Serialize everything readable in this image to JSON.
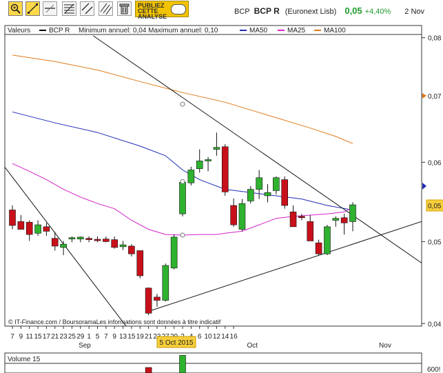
{
  "toolbar": {
    "tools": [
      "zoom-tool",
      "line-tool",
      "horizontal-line-tool",
      "fibonacci-tool",
      "channel-tool",
      "parallel-lines-tool",
      "delete-tool"
    ],
    "promo_lines": [
      "PUBLIEZ",
      "CETTE",
      "ANALYSE"
    ]
  },
  "quote": {
    "symbol": "BCP",
    "name": "BCP R",
    "exchange": "(Euronext Lisb)",
    "price": "0,05",
    "change": "+4,40%",
    "date": "2 Nov"
  },
  "legend": {
    "label": "Valeurs",
    "items": [
      {
        "name": "BCP R",
        "color": "#000000"
      },
      {
        "name": "MA50",
        "color": "#1f2bb5"
      },
      {
        "name": "MA25",
        "color": "#d321c8"
      },
      {
        "name": "MA100",
        "color": "#e07a1a"
      }
    ],
    "minmax": "Minimum annuel: 0,04 Maximum annuel: 0,10"
  },
  "price_axis": {
    "labels": [
      {
        "value": 0.0805,
        "text": "0,08"
      },
      {
        "value": 0.0715,
        "text": "0,07"
      },
      {
        "value": 0.0612,
        "text": "0,06"
      },
      {
        "value": 0.0489,
        "text": "0,05"
      },
      {
        "value": 0.0362,
        "text": "0,04"
      }
    ],
    "current_text": "0,05"
  },
  "x_axis": {
    "ticks": [
      "7",
      "9",
      "11",
      "15",
      "17",
      "21",
      "23",
      "25",
      "29",
      "1",
      "5",
      "7",
      "9",
      "13",
      "15",
      "19",
      "21",
      "23",
      "27",
      "29",
      "2",
      "4",
      "6",
      "10",
      "12",
      "14",
      "16"
    ],
    "months": [
      "Sep",
      "Oct",
      "Nov"
    ],
    "highlight_date": "5 Oct 2015"
  },
  "source_note": "© IT-Finance.com / BoursoramaLes informations sont données à titre indicatif",
  "volume": {
    "label": "Volume 15",
    "axis_label": "600!"
  },
  "chart_data": {
    "type": "candlestick",
    "series": [
      {
        "name": "BCP R",
        "ohlc": [
          [
            0.0538,
            0.0545,
            0.0508,
            0.0514
          ],
          [
            0.052,
            0.053,
            0.051,
            0.0508
          ],
          [
            0.0519,
            0.0522,
            0.049,
            0.05
          ],
          [
            0.0502,
            0.0522,
            0.0498,
            0.0515
          ],
          [
            0.0512,
            0.0518,
            0.0498,
            0.0505
          ],
          [
            0.0494,
            0.0504,
            0.0475,
            0.0482
          ],
          [
            0.048,
            0.049,
            0.0468,
            0.0485
          ],
          [
            0.0493,
            0.0497,
            0.0488,
            0.0495
          ],
          [
            0.0493,
            0.0497,
            0.0488,
            0.0496
          ],
          [
            0.0494,
            0.0497,
            0.0488,
            0.0492
          ],
          [
            0.0492,
            0.0497,
            0.0488,
            0.0491
          ],
          [
            0.0493,
            0.0497,
            0.0488,
            0.0489
          ],
          [
            0.0492,
            0.0497,
            0.0478,
            0.048
          ],
          [
            0.0481,
            0.049,
            0.0476,
            0.0484
          ],
          [
            0.0482,
            0.0485,
            0.0466,
            0.047
          ],
          [
            0.0475,
            0.0475,
            0.0432,
            0.0436
          ],
          [
            0.0417,
            0.0418,
            0.0375,
            0.0378
          ],
          [
            0.0403,
            0.0408,
            0.0388,
            0.0398
          ],
          [
            0.0398,
            0.0455,
            0.0396,
            0.0452
          ],
          [
            0.0448,
            0.05,
            0.0446,
            0.0496
          ],
          [
            0.0532,
            0.0585,
            0.0528,
            0.0581
          ],
          [
            0.058,
            0.0605,
            0.0576,
            0.06
          ],
          [
            0.0602,
            0.0632,
            0.0596,
            0.0614
          ],
          [
            0.0615,
            0.062,
            0.0598,
            0.0615
          ],
          [
            0.0632,
            0.0658,
            0.0622,
            0.0635
          ],
          [
            0.0636,
            0.064,
            0.056,
            0.0566
          ],
          [
            0.0545,
            0.0556,
            0.0512,
            0.0515
          ],
          [
            0.0508,
            0.0555,
            0.0505,
            0.0548
          ],
          [
            0.0552,
            0.0575,
            0.0548,
            0.057
          ],
          [
            0.057,
            0.06,
            0.0555,
            0.0588
          ],
          [
            0.056,
            0.0578,
            0.055,
            0.0565
          ],
          [
            0.0568,
            0.059,
            0.0562,
            0.0588
          ],
          [
            0.0585,
            0.059,
            0.054,
            0.0545
          ],
          [
            0.0535,
            0.0545,
            0.0512,
            0.0512
          ],
          [
            0.0528,
            0.0532,
            0.0522,
            0.0526
          ],
          [
            0.052,
            0.053,
            0.049,
            0.049
          ],
          [
            0.0487,
            0.0492,
            0.0468,
            0.047
          ],
          [
            0.047,
            0.0515,
            0.0468,
            0.0512
          ],
          [
            0.0522,
            0.0528,
            0.0512,
            0.0525
          ],
          [
            0.0526,
            0.0532,
            0.05,
            0.0518
          ],
          [
            0.052,
            0.055,
            0.0505,
            0.0546
          ]
        ]
      },
      {
        "name": "MA50",
        "points": [
          [
            0,
            0.069
          ],
          [
            5,
            0.0673
          ],
          [
            10,
            0.0658
          ],
          [
            15,
            0.0637
          ],
          [
            18,
            0.0622
          ],
          [
            20,
            0.06
          ],
          [
            22,
            0.0585
          ],
          [
            25,
            0.057
          ],
          [
            28,
            0.0565
          ],
          [
            31,
            0.056
          ],
          [
            34,
            0.0555
          ],
          [
            37,
            0.0545
          ],
          [
            40,
            0.0538
          ]
        ]
      },
      {
        "name": "MA25",
        "points": [
          [
            0,
            0.061
          ],
          [
            2,
            0.0598
          ],
          [
            4,
            0.0585
          ],
          [
            6,
            0.057
          ],
          [
            8,
            0.0558
          ],
          [
            10,
            0.0548
          ],
          [
            12,
            0.054
          ],
          [
            14,
            0.0522
          ],
          [
            16,
            0.0508
          ],
          [
            18,
            0.05
          ],
          [
            20,
            0.0499
          ],
          [
            22,
            0.05
          ],
          [
            24,
            0.05
          ],
          [
            25,
            0.0502
          ],
          [
            27,
            0.0505
          ],
          [
            29,
            0.0515
          ],
          [
            31,
            0.0525
          ],
          [
            33,
            0.0528
          ],
          [
            35,
            0.053
          ],
          [
            37,
            0.0532
          ],
          [
            39,
            0.0535
          ],
          [
            40,
            0.0542
          ]
        ]
      },
      {
        "name": "MA100",
        "points": [
          [
            0,
            0.0778
          ],
          [
            5,
            0.0768
          ],
          [
            10,
            0.0755
          ],
          [
            15,
            0.0737
          ],
          [
            20,
            0.072
          ],
          [
            25,
            0.0705
          ],
          [
            30,
            0.0685
          ],
          [
            35,
            0.0665
          ],
          [
            38,
            0.0652
          ],
          [
            40,
            0.0641
          ]
        ]
      }
    ],
    "trendlines": [
      {
        "from": [
          -1.1,
          0.0608
        ],
        "to": [
          14.4,
          0.034
        ]
      },
      {
        "from": [
          9.5,
          0.0808
        ],
        "to": [
          50.6,
          0.0433
        ]
      },
      {
        "from": [
          15.8,
          0.038
        ],
        "to": [
          50.6,
          0.0531
        ]
      }
    ],
    "markers": [
      {
        "x": 20,
        "y": 0.0582
      },
      {
        "x": 20,
        "y": 0.0499
      },
      {
        "x": 20,
        "y": 0.0702
      }
    ],
    "volume": [
      0,
      0,
      0,
      0,
      0,
      0,
      0,
      0,
      0,
      0,
      0,
      0,
      0,
      0,
      0,
      0,
      0.5,
      0,
      0,
      0,
      1.6,
      0,
      0,
      0,
      0,
      0,
      0,
      0,
      0,
      0,
      0,
      0,
      0,
      0,
      0,
      0,
      0,
      0,
      0,
      0,
      0
    ]
  }
}
